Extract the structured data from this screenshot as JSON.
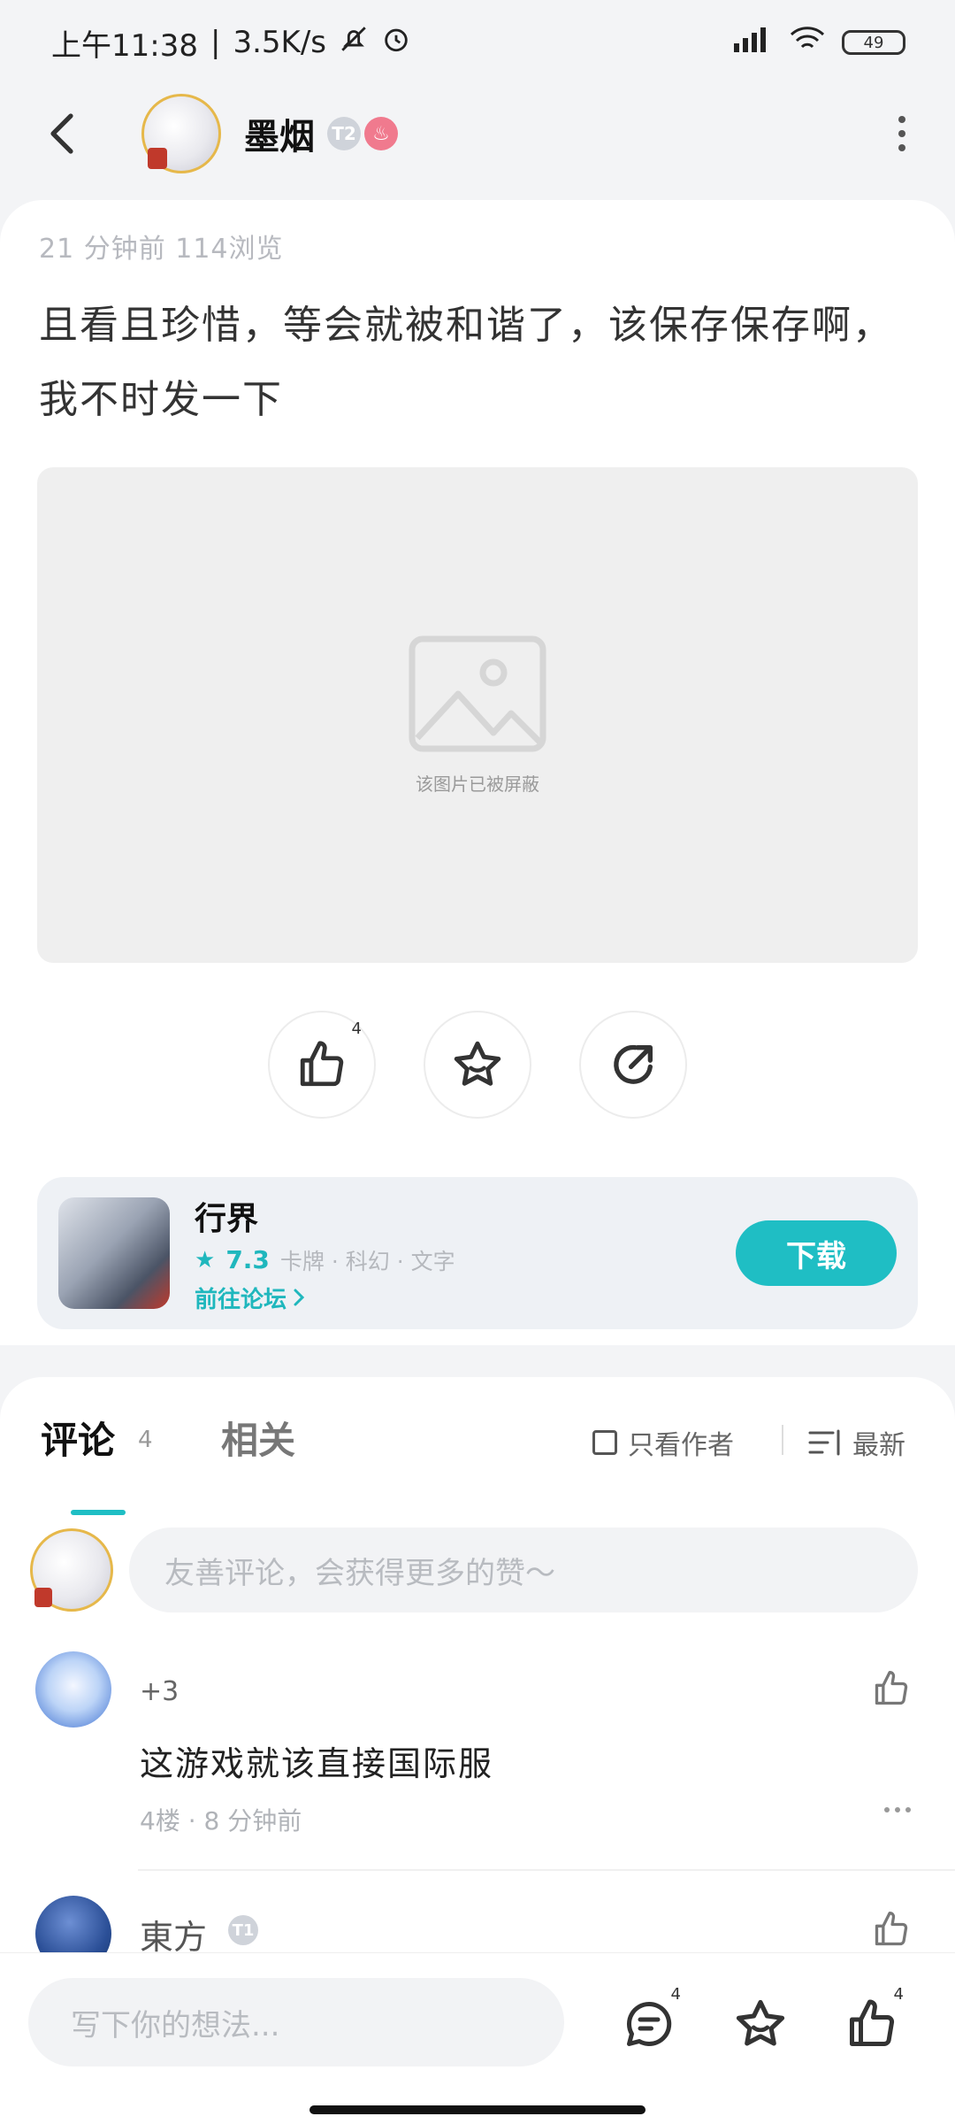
{
  "status_bar": {
    "time": "上午11:38",
    "speed": "3.5K/s",
    "battery": "49"
  },
  "header": {
    "username": "墨烟",
    "level_badge": "T2"
  },
  "post": {
    "meta": "21 分钟前 114浏览",
    "text": "且看且珍惜，等会就被和谐了，该保存保存啊，我不时发一下",
    "blocked_caption": "该图片已被屏蔽",
    "like_count": "4"
  },
  "game_card": {
    "name": "行界",
    "rating": "7.3",
    "tags": "卡牌 · 科幻 · 文字",
    "forum_link": "前往论坛",
    "download_label": "下载"
  },
  "comments": {
    "tab_comments": "评论",
    "tab_comments_count": "4",
    "tab_related": "相关",
    "author_only": "只看作者",
    "sort": "最新",
    "input_placeholder": "友善评论，会获得更多的赞～",
    "items": [
      {
        "name": "+3",
        "text": "这游戏就该直接国际服",
        "meta": "4楼 · 8 分钟前"
      },
      {
        "name": "東方",
        "badge": "T1"
      }
    ]
  },
  "bottom_bar": {
    "input_placeholder": "写下你的想法...",
    "comment_count": "4",
    "like_count": "4"
  },
  "icons": {
    "back": "back-arrow-icon",
    "more": "more-vertical-icon",
    "like": "thumbs-up-icon",
    "favorite": "star-icon",
    "share": "share-icon",
    "comment": "comment-icon",
    "sort": "sort-list-icon",
    "image_placeholder": "image-icon"
  },
  "colors": {
    "accent": "#1fbec4",
    "rating": "#1fb7bd"
  }
}
